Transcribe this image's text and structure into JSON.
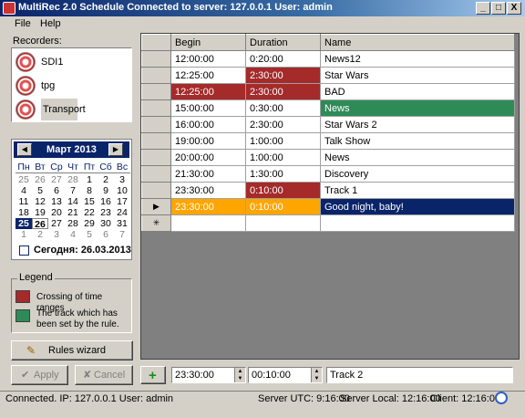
{
  "window": {
    "title": "MultiRec 2.0 Schedule  Connected to server: 127.0.0.1  User: admin",
    "minimize": "_",
    "maximize": "□",
    "close": "X"
  },
  "menu": [
    "File",
    "Help"
  ],
  "recorders": {
    "label": "Recorders:",
    "items": [
      {
        "label": "SDI1",
        "icon": "recorder-icon"
      },
      {
        "label": "tpg",
        "icon": "recorder-icon"
      },
      {
        "label": "Transport",
        "icon": "recorder-icon",
        "selected": true
      }
    ]
  },
  "calendar": {
    "month": "Март 2013",
    "prev": "◀",
    "next": "▶",
    "weekdays": [
      "Пн",
      "Вт",
      "Ср",
      "Чт",
      "Пт",
      "Сб",
      "Вс"
    ],
    "weeks": [
      [
        "25",
        "26",
        "27",
        "28",
        "1",
        "2",
        "3"
      ],
      [
        "4",
        "5",
        "6",
        "7",
        "8",
        "9",
        "10"
      ],
      [
        "11",
        "12",
        "13",
        "14",
        "15",
        "16",
        "17"
      ],
      [
        "18",
        "19",
        "20",
        "21",
        "22",
        "23",
        "24"
      ],
      [
        "25",
        "26",
        "27",
        "28",
        "29",
        "30",
        "31"
      ],
      [
        "1",
        "2",
        "3",
        "4",
        "5",
        "6",
        "7"
      ]
    ],
    "selected_day": "25",
    "today_day": "26",
    "today_label": "Сегодня: 26.03.2013"
  },
  "legend": {
    "title": "Legend",
    "items": [
      {
        "text": "Crossing of time ranges",
        "color": "#a52a2a"
      },
      {
        "text": "The track which has been set by the rule.",
        "color": "#2e8b57"
      }
    ]
  },
  "buttons": {
    "rules_wizard": "Rules wizard",
    "apply": "Apply",
    "cancel": "Cancel",
    "add": "+"
  },
  "schedule": {
    "columns": [
      "Begin",
      "Duration",
      "Name"
    ],
    "rows": [
      {
        "begin": "12:00:00",
        "duration": "0:20:00",
        "name": "News12",
        "state": ""
      },
      {
        "begin": "12:25:00",
        "duration": "2:30:00",
        "name": "Star Wars",
        "state": "conflict-duration"
      },
      {
        "begin": "12:25:00",
        "duration": "2:30:00",
        "name": "BAD",
        "state": "conflict-begin-duration"
      },
      {
        "begin": "15:00:00",
        "duration": "0:30:00",
        "name": "News",
        "state": "rule"
      },
      {
        "begin": "16:00:00",
        "duration": "2:30:00",
        "name": "Star Wars 2",
        "state": ""
      },
      {
        "begin": "19:00:00",
        "duration": "1:00:00",
        "name": "Talk Show",
        "state": ""
      },
      {
        "begin": "20:00:00",
        "duration": "1:00:00",
        "name": "News",
        "state": ""
      },
      {
        "begin": "21:30:00",
        "duration": "1:30:00",
        "name": "Discovery",
        "state": ""
      },
      {
        "begin": "23:30:00",
        "duration": "0:10:00",
        "name": "Track 1",
        "state": "conflict-duration"
      },
      {
        "begin": "23:30:00",
        "duration": "0:10:00",
        "name": "Good night, baby!",
        "state": "selected"
      }
    ],
    "current_row_marker": "▶",
    "new_row_marker": "✳"
  },
  "editor": {
    "begin": "23:30:00",
    "duration": "00:10:00",
    "name": "Track 2"
  },
  "status": {
    "connection": "Connected. IP: 127.0.0.1 User: admin",
    "server_utc": "Server UTC: 9:16:00",
    "server_local": "Server Local: 12:16:00",
    "client": "Client: 12:16:00"
  }
}
